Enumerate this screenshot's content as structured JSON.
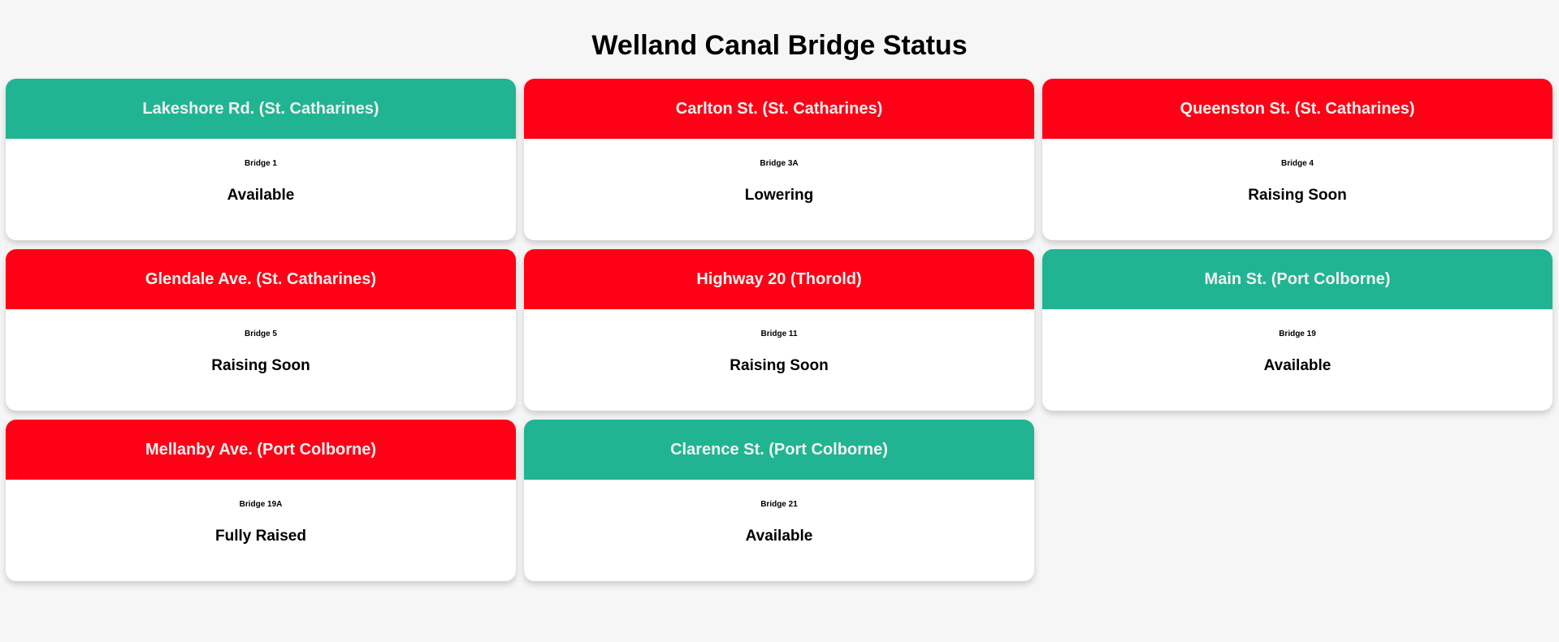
{
  "page": {
    "title": "Welland Canal Bridge Status"
  },
  "colors": {
    "available_header": "#21b492",
    "unavailable_header": "#ff0016",
    "background": "#f6f6f6"
  },
  "bridges": [
    {
      "name": "Lakeshore Rd. (St. Catharines)",
      "bridge": "Bridge 1",
      "status": "Available",
      "header_color": "#21b492"
    },
    {
      "name": "Carlton St. (St. Catharines)",
      "bridge": "Bridge 3A",
      "status": "Lowering",
      "header_color": "#ff0016"
    },
    {
      "name": "Queenston St. (St. Catharines)",
      "bridge": "Bridge 4",
      "status": "Raising Soon",
      "header_color": "#ff0016"
    },
    {
      "name": "Glendale Ave. (St. Catharines)",
      "bridge": "Bridge 5",
      "status": "Raising Soon",
      "header_color": "#ff0016"
    },
    {
      "name": "Highway 20 (Thorold)",
      "bridge": "Bridge 11",
      "status": "Raising Soon",
      "header_color": "#ff0016"
    },
    {
      "name": "Main St. (Port Colborne)",
      "bridge": "Bridge 19",
      "status": "Available",
      "header_color": "#21b492"
    },
    {
      "name": "Mellanby Ave. (Port Colborne)",
      "bridge": "Bridge 19A",
      "status": "Fully Raised",
      "header_color": "#ff0016"
    },
    {
      "name": "Clarence St. (Port Colborne)",
      "bridge": "Bridge 21",
      "status": "Available",
      "header_color": "#21b492"
    }
  ]
}
